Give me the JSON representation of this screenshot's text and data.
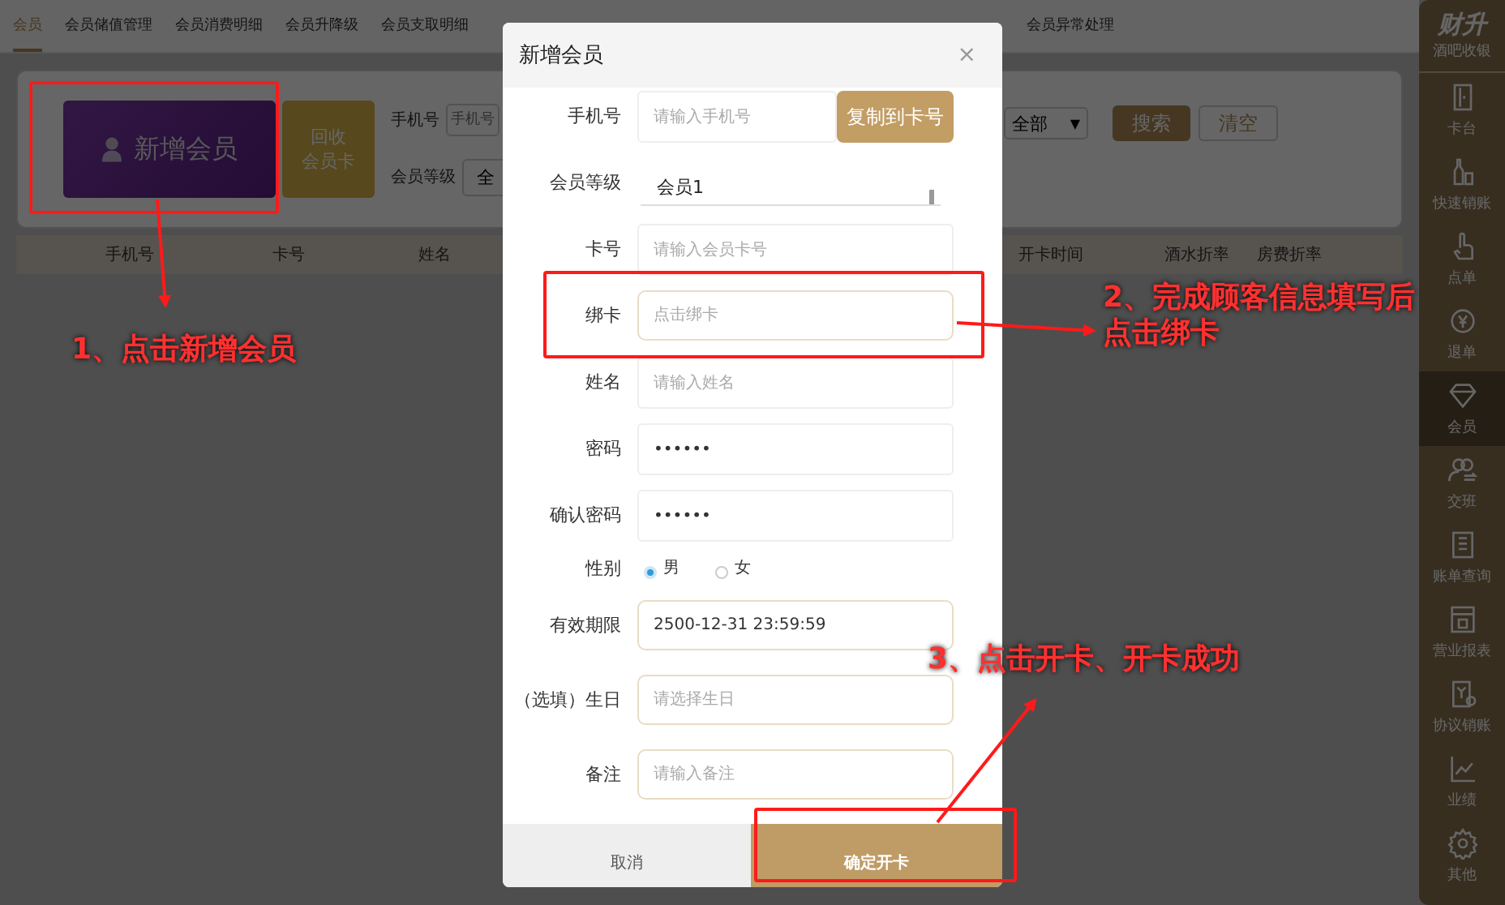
{
  "tabs": [
    {
      "label": "会员",
      "selected": true
    },
    {
      "label": "会员储值管理",
      "selected": false
    },
    {
      "label": "会员消费明细",
      "selected": false
    },
    {
      "label": "会员升降级",
      "selected": false
    },
    {
      "label": "会员支取明细",
      "selected": false
    },
    {
      "label": "会员异常处理",
      "selected": false
    }
  ],
  "toolbar": {
    "add_button": "新增会员",
    "recycle_button_lines": [
      "回收",
      "会员卡"
    ],
    "phone_label": "手机号",
    "phone_placeholder": "手机号",
    "level_label": "会员等级",
    "level_value": "全",
    "status_value": "全部",
    "status_caret": "▼",
    "search_button": "搜索",
    "clear_button": "清空"
  },
  "table": {
    "columns": [
      "手机号",
      "卡号",
      "姓名",
      "开卡时间",
      "酒水折率",
      "房费折率"
    ]
  },
  "sidebar": {
    "brand": "财升",
    "subtitle": "酒吧收银",
    "items": [
      {
        "label": "卡台",
        "selected": false
      },
      {
        "label": "快速销账",
        "selected": false
      },
      {
        "label": "点单",
        "selected": false
      },
      {
        "label": "退单",
        "selected": false
      },
      {
        "label": "会员",
        "selected": true
      },
      {
        "label": "交班",
        "selected": false
      },
      {
        "label": "账单查询",
        "selected": false
      },
      {
        "label": "营业报表",
        "selected": false
      },
      {
        "label": "协议销账",
        "selected": false
      },
      {
        "label": "业绩",
        "selected": false
      },
      {
        "label": "其他",
        "selected": false
      }
    ]
  },
  "dialog": {
    "title": "新增会员",
    "close": "×",
    "fields": [
      {
        "kind": "input_button",
        "label": "手机号",
        "placeholder": "请输入手机号",
        "button": "复制到卡号"
      },
      {
        "kind": "select",
        "label": "会员等级",
        "value": "会员1"
      },
      {
        "kind": "input",
        "label": "卡号",
        "placeholder": "请输入会员卡号"
      },
      {
        "kind": "picker",
        "label": "绑卡",
        "placeholder": "点击绑卡"
      },
      {
        "kind": "input",
        "label": "姓名",
        "placeholder": "请输入姓名"
      },
      {
        "kind": "input",
        "label": "密码",
        "value": "••••••"
      },
      {
        "kind": "input",
        "label": "确认密码",
        "value": "••••••"
      },
      {
        "kind": "radio",
        "label": "性别",
        "options": [
          {
            "label": "男",
            "selected": true
          },
          {
            "label": "女",
            "selected": false
          }
        ]
      },
      {
        "kind": "picker",
        "label": "有效期限",
        "value": "2500-12-31 23:59:59"
      },
      {
        "kind": "picker",
        "label": "（选填）生日",
        "placeholder": "请选择生日"
      },
      {
        "kind": "picker",
        "label": "备注",
        "placeholder": "请输入备注"
      }
    ],
    "cancel_button": "取消",
    "confirm_button": "确定开卡"
  },
  "annotations": [
    {
      "lines": [
        "1、点击新增会员"
      ]
    },
    {
      "lines": [
        "2、完成顾客信息填写后",
        "点击绑卡"
      ]
    },
    {
      "lines": [
        "3、点击开卡、开卡成功"
      ]
    }
  ]
}
